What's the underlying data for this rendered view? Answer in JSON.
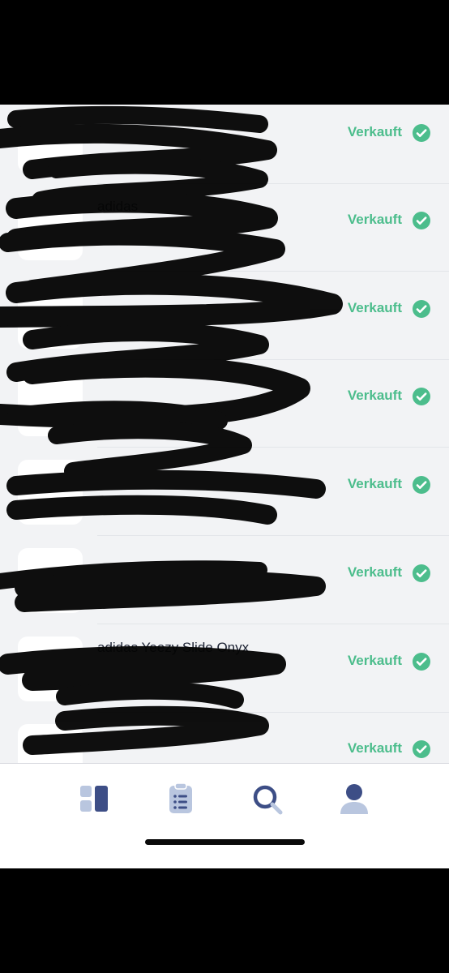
{
  "list": {
    "items": [
      {
        "name": "",
        "meta": "",
        "status": "Verkauft"
      },
      {
        "name": "adidas",
        "meta": "",
        "status": "Verkauft"
      },
      {
        "name": "",
        "meta": "",
        "status": "Verkauft"
      },
      {
        "name": "",
        "meta": "",
        "status": "Verkauft"
      },
      {
        "name": "",
        "meta": "",
        "status": "Verkauft"
      },
      {
        "name": "",
        "meta": "",
        "status": "Verkauft"
      },
      {
        "name": "adidas Yeezy Slide Onyx",
        "meta": "",
        "status": "Verkauft"
      },
      {
        "name": "",
        "meta": "",
        "status": "Verkauft"
      }
    ]
  },
  "colors": {
    "status_green": "#4cbd8c",
    "tab_active": "#3d4e86",
    "tab_inactive": "#b9c6df",
    "background": "#f2f3f5"
  },
  "tabbar": {
    "tabs": [
      {
        "icon": "dashboard-icon"
      },
      {
        "icon": "orders-icon"
      },
      {
        "icon": "search-icon"
      },
      {
        "icon": "profile-icon"
      }
    ]
  }
}
